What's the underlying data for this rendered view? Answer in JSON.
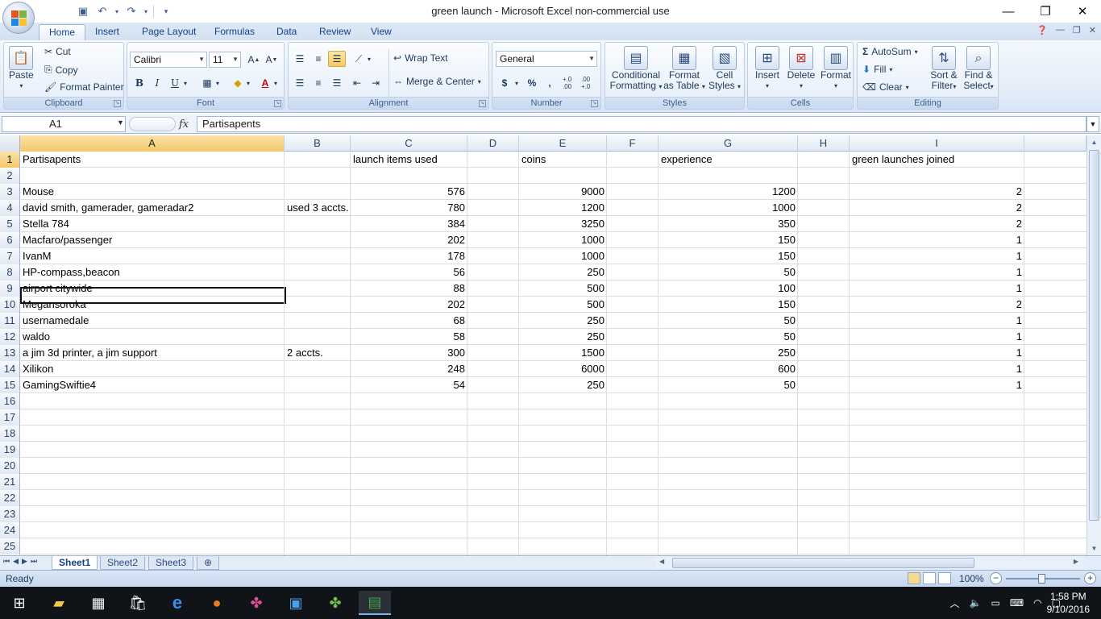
{
  "window": {
    "title": "green launch - Microsoft Excel non-commercial use",
    "controls": [
      "minimize-icon",
      "restore-icon",
      "close-icon"
    ]
  },
  "ribbon_tabs": [
    "Home",
    "Insert",
    "Page Layout",
    "Formulas",
    "Data",
    "Review",
    "View"
  ],
  "ribbon": {
    "clipboard": {
      "label": "Clipboard",
      "paste": "Paste",
      "cut": "Cut",
      "copy": "Copy",
      "format_painter": "Format Painter"
    },
    "font": {
      "label": "Font",
      "name": "Calibri",
      "size": "11",
      "bold": "B",
      "italic": "I",
      "underline": "U"
    },
    "alignment": {
      "label": "Alignment",
      "wrap_text": "Wrap Text",
      "merge_center": "Merge & Center"
    },
    "number": {
      "label": "Number",
      "format": "General",
      "currency": "$",
      "percent": "%",
      "comma": ",",
      "inc_decimal": "+.0 .00",
      "dec_decimal": ".00 +.0"
    },
    "styles": {
      "label": "Styles",
      "conditional": [
        "Conditional",
        "Formatting"
      ],
      "format_table": [
        "Format",
        "as Table"
      ],
      "cell_styles": [
        "Cell",
        "Styles"
      ]
    },
    "cells": {
      "label": "Cells",
      "insert": "Insert",
      "delete": "Delete",
      "format": "Format"
    },
    "editing": {
      "label": "Editing",
      "autosum": "AutoSum",
      "fill": "Fill",
      "clear": "Clear",
      "sort": [
        "Sort &",
        "Filter"
      ],
      "find": [
        "Find &",
        "Select"
      ]
    }
  },
  "formula_bar": {
    "name_box": "A1",
    "fx": "fx",
    "content": "Partisapents"
  },
  "columns": [
    "A",
    "B",
    "C",
    "D",
    "E",
    "F",
    "G",
    "H",
    "I"
  ],
  "rows": [
    {
      "n": "1",
      "A": "Partisapents",
      "B": "",
      "C": "launch items used",
      "E": "coins",
      "G": "experience",
      "I": "green launches joined"
    },
    {
      "n": "2",
      "A": "",
      "B": "",
      "C": "",
      "E": "",
      "G": "",
      "I": ""
    },
    {
      "n": "3",
      "A": "Mouse",
      "B": "",
      "C": "576",
      "E": "9000",
      "G": "1200",
      "I": "2"
    },
    {
      "n": "4",
      "A": "david smith, gamerader, gameradar2",
      "B": "used 3 accts.",
      "C": "780",
      "E": "1200",
      "G": "1000",
      "I": "2"
    },
    {
      "n": "5",
      "A": "Stella 784",
      "B": "",
      "C": "384",
      "E": "3250",
      "G": "350",
      "I": "2"
    },
    {
      "n": "6",
      "A": "Macfaro/passenger",
      "B": "",
      "C": "202",
      "E": "1000",
      "G": "150",
      "I": "1"
    },
    {
      "n": "7",
      "A": "IvanM",
      "B": "",
      "C": "178",
      "E": "1000",
      "G": "150",
      "I": "1"
    },
    {
      "n": "8",
      "A": "HP-compass,beacon",
      "B": "",
      "C": "56",
      "E": "250",
      "G": "50",
      "I": "1"
    },
    {
      "n": "9",
      "A": "airport citywide",
      "B": "",
      "C": "88",
      "E": "500",
      "G": "100",
      "I": "1"
    },
    {
      "n": "10",
      "A": "Megansoroka",
      "B": "",
      "C": "202",
      "E": "500",
      "G": "150",
      "I": "2"
    },
    {
      "n": "11",
      "A": "usernamedale",
      "B": "",
      "C": "68",
      "E": "250",
      "G": "50",
      "I": "1"
    },
    {
      "n": "12",
      "A": "waldo",
      "B": "",
      "C": "58",
      "E": "250",
      "G": "50",
      "I": "1"
    },
    {
      "n": "13",
      "A": "a jim 3d printer, a jim support",
      "B": "2 accts.",
      "C": "300",
      "E": "1500",
      "G": "250",
      "I": "1"
    },
    {
      "n": "14",
      "A": "Xilikon",
      "B": "",
      "C": "248",
      "E": "6000",
      "G": "600",
      "I": "1"
    },
    {
      "n": "15",
      "A": "GamingSwiftie4",
      "B": "",
      "C": "54",
      "E": "250",
      "G": "50",
      "I": "1"
    },
    {
      "n": "16"
    },
    {
      "n": "17"
    },
    {
      "n": "18"
    },
    {
      "n": "19"
    },
    {
      "n": "20"
    },
    {
      "n": "21"
    },
    {
      "n": "22"
    },
    {
      "n": "23"
    },
    {
      "n": "24"
    },
    {
      "n": "25"
    }
  ],
  "sheets": [
    "Sheet1",
    "Sheet2",
    "Sheet3"
  ],
  "status": {
    "text": "Ready",
    "zoom": "100%",
    "zoom_minus": "−",
    "zoom_plus": "+"
  },
  "taskbar": {
    "icons": [
      "windows-start-icon",
      "file-explorer-icon",
      "calculator-icon",
      "store-icon",
      "edge-icon",
      "firefox-icon",
      "pinwheel-app-icon",
      "monitor-app-icon",
      "pinwheel-app-2-icon",
      "excel-icon"
    ],
    "time": "1:58 PM",
    "date": "9/10/2016"
  }
}
